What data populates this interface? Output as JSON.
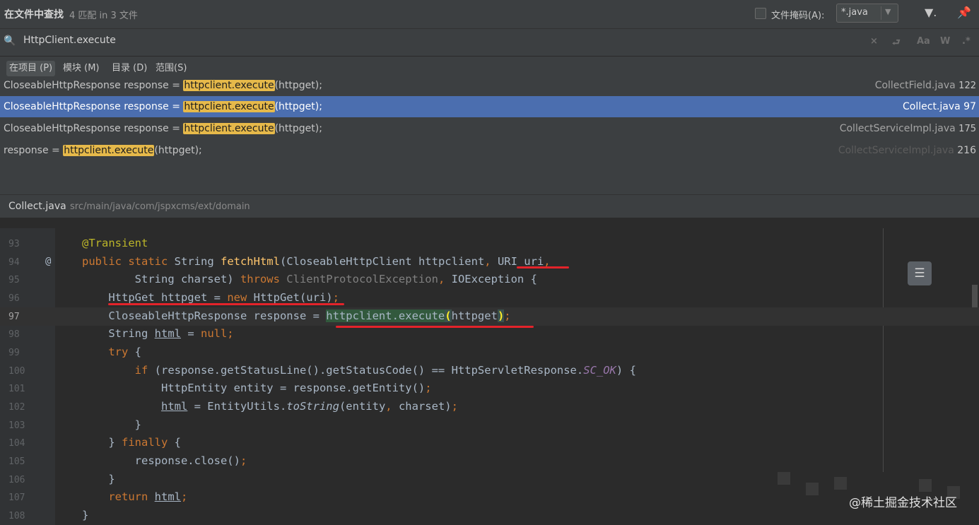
{
  "header": {
    "title": "在文件中查找",
    "match_count": "4 匹配 in 3 文件",
    "file_mask_label": "文件掩码(A):",
    "file_mask_value": "*.java"
  },
  "search": {
    "value": "HttpClient.execute",
    "placeholder": ""
  },
  "scopes": [
    {
      "label": "在项目 (P)",
      "active": true
    },
    {
      "label": "模块 (M)",
      "active": false
    },
    {
      "label": "目录 (D)",
      "active": false
    },
    {
      "label": "范围(S)",
      "active": false
    }
  ],
  "results": [
    {
      "prefix": "CloseableHttpResponse response = ",
      "match": "httpclient.execute",
      "suffix": "(httpget);",
      "file": "CollectField.java",
      "line": "122",
      "selected": false
    },
    {
      "prefix": "CloseableHttpResponse response = ",
      "match": "httpclient.execute",
      "suffix": "(httpget);",
      "file": "Collect.java",
      "line": "97",
      "selected": true
    },
    {
      "prefix": "CloseableHttpResponse response = ",
      "match": "httpclient.execute",
      "suffix": "(httpget);",
      "file": "CollectServiceImpl.java",
      "line": "175",
      "selected": false
    },
    {
      "prefix": "response = ",
      "match": "httpclient.execute",
      "suffix": "(httpget);",
      "file": "CollectServiceImpl.java",
      "line": "216",
      "selected": false
    }
  ],
  "preview": {
    "file": "Collect.java",
    "path": "src/main/java/com/jspxcms/ext/domain",
    "line_numbers": [
      "93",
      "94",
      "95",
      "96",
      "97",
      "98",
      "99",
      "100",
      "101",
      "102",
      "103",
      "104",
      "105",
      "106",
      "107",
      "108"
    ]
  },
  "watermark": "@稀土掘金技术社区"
}
